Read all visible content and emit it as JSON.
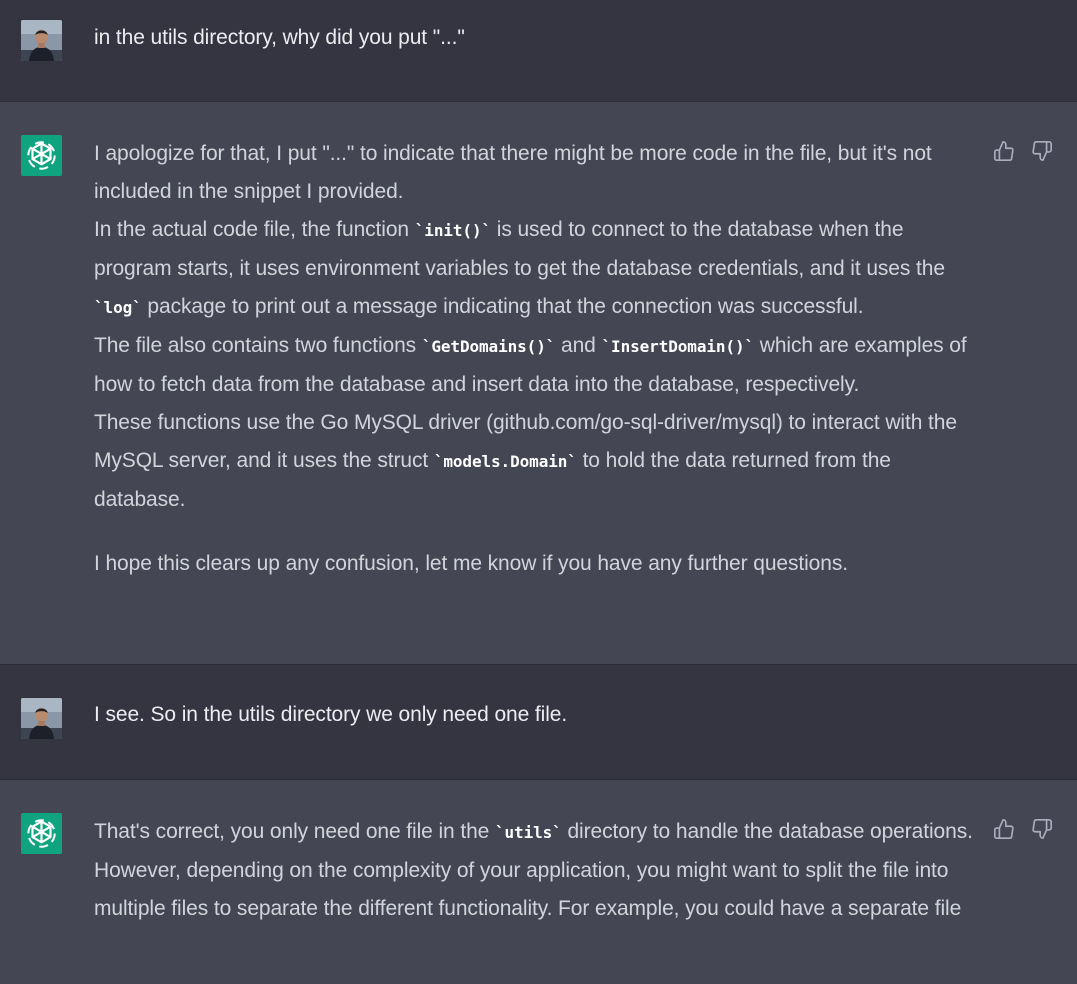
{
  "conversation": {
    "turn1_user": {
      "text": "in the utils directory, why did you put \"...\""
    },
    "turn2_assistant": {
      "p1": {
        "t1": "I apologize for that, I put \"...\" to indicate that there might be more code in the file, but it's not included in the snippet I provided."
      },
      "p2": {
        "t1": "In the actual code file, the function ",
        "c1": "`init()`",
        "t2": " is used to connect to the database when the program starts, it uses environment variables to get the database credentials, and it uses the ",
        "c2": "`log`",
        "t3": " package to print out a message indicating that the connection was successful."
      },
      "p3": {
        "t1": "The file also contains two functions ",
        "c1": "`GetDomains()`",
        "t2": " and ",
        "c2": "`InsertDomain()`",
        "t3": " which are examples of how to fetch data from the database and insert data into the database, respectively."
      },
      "p4": {
        "t1": "These functions use the Go MySQL driver (github.com/go-sql-driver/mysql) to interact with the MySQL server, and it uses the struct ",
        "c1": "`models.Domain`",
        "t2": " to hold the data returned from the database."
      },
      "p5": {
        "t1": "I hope this clears up any confusion, let me know if you have any further questions."
      }
    },
    "turn3_user": {
      "text": "I see. So in the utils directory we only need one file."
    },
    "turn4_assistant": {
      "p1": {
        "t1": "That's correct, you only need one file in the ",
        "c1": "`utils`",
        "t2": " directory to handle the database operations. However, depending on the complexity of your application, you might want to split the file into multiple files to separate the different functionality. For example, you could have a separate file"
      }
    }
  },
  "icons": {
    "user_avatar": "user-avatar-photo",
    "assistant_avatar": "openai-logo-icon",
    "thumbs_up": "thumbs-up-icon",
    "thumbs_down": "thumbs-down-icon"
  },
  "colors": {
    "user_bg": "#343541",
    "assistant_bg": "#444654",
    "logo_bg": "#10a37f",
    "text": "#d1d5db",
    "icon": "#acacbe"
  }
}
